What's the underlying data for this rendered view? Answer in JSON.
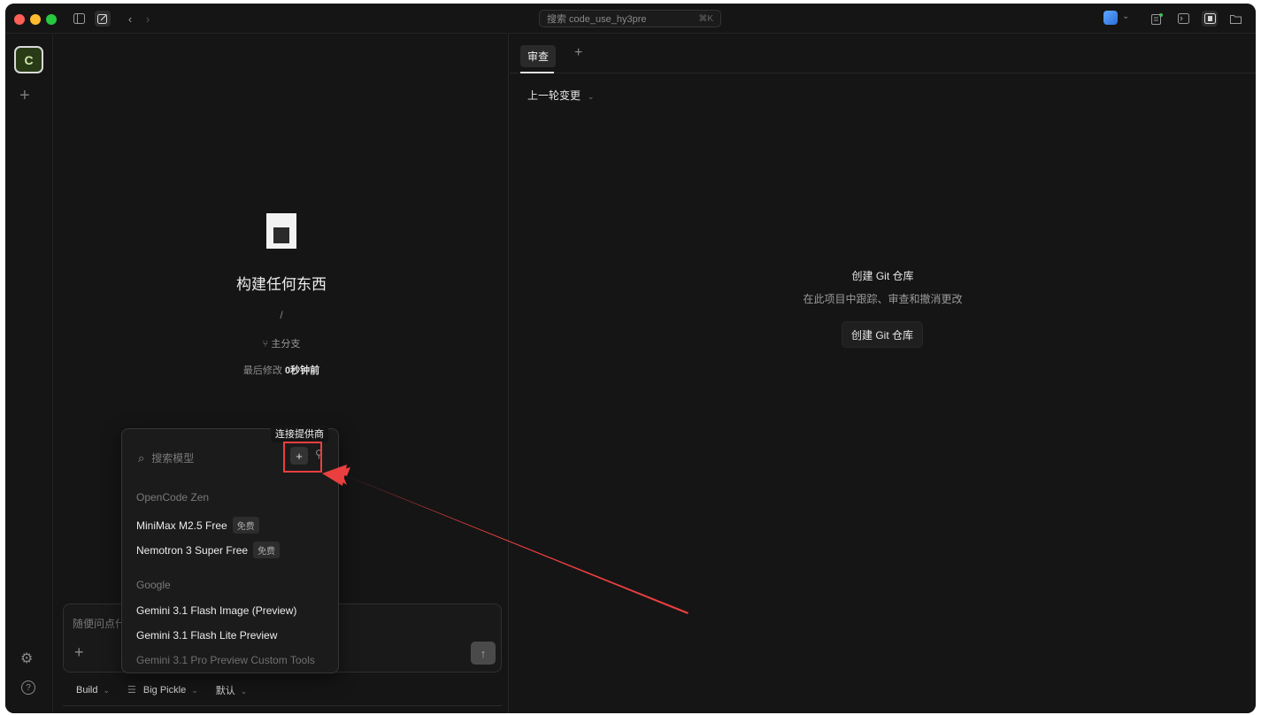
{
  "titlebar": {
    "search_placeholder": "搜索 code_use_hy3pre",
    "search_shortcut": "⌘K"
  },
  "rail": {
    "avatar_letter": "C"
  },
  "center": {
    "headline": "构建任何东西",
    "path": "/",
    "branch_label": "主分支",
    "modified_label": "最后修改",
    "modified_value": "0秒钟前",
    "composer_placeholder": "随便问点什",
    "bottom": {
      "agent": "Build",
      "model": "Big Pickle",
      "variant": "默认"
    }
  },
  "popup": {
    "tooltip": "连接提供商",
    "search_placeholder": "搜索模型",
    "groups": [
      {
        "label": "OpenCode Zen",
        "models": [
          {
            "name": "MiniMax M2.5 Free",
            "badge": "免费"
          },
          {
            "name": "Nemotron 3 Super Free",
            "badge": "免费"
          }
        ]
      },
      {
        "label": "Google",
        "models": [
          {
            "name": "Gemini 3.1 Flash Image (Preview)"
          },
          {
            "name": "Gemini 3.1 Flash Lite Preview"
          },
          {
            "name": "Gemini 3.1 Pro Preview Custom Tools"
          }
        ]
      }
    ]
  },
  "right": {
    "tab_review": "审查",
    "changes_select": "上一轮变更",
    "git_title": "创建 Git 仓库",
    "git_desc": "在此项目中跟踪、审查和撤消更改",
    "git_button": "创建 Git 仓库"
  },
  "colors": {
    "accent_red": "#ea3f3f",
    "background": "#151515"
  }
}
